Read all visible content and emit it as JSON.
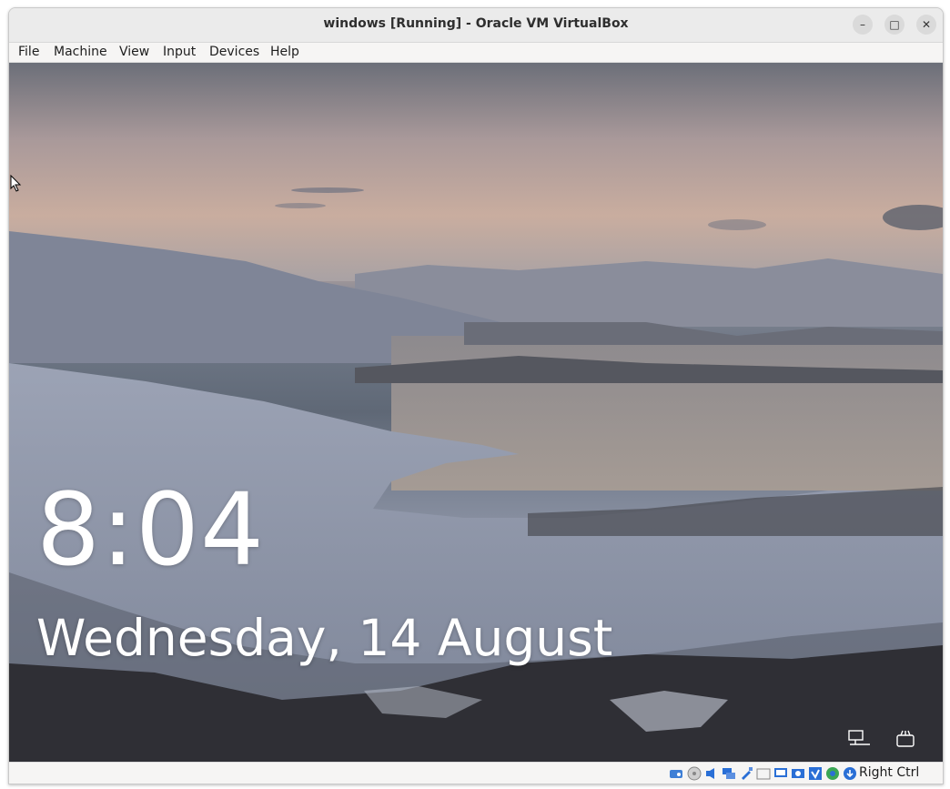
{
  "window": {
    "title": "windows [Running] - Oracle VM VirtualBox"
  },
  "window_controls": {
    "minimize": "–",
    "maximize": "□",
    "close": "✕"
  },
  "menu": [
    "File",
    "Machine",
    "View",
    "Input",
    "Devices",
    "Help"
  ],
  "lockscreen": {
    "time": "8:04",
    "date": "Wednesday, 14 August",
    "icons": [
      "network-icon",
      "accessibility-icon"
    ]
  },
  "statusbar": {
    "icons": [
      "hard-disk-icon",
      "optical-drive-icon",
      "audio-icon",
      "network-adapter-icon",
      "usb-icon",
      "shared-folders-icon",
      "display-icon",
      "recording-icon",
      "cpu-icon",
      "guest-additions-icon",
      "mouse-integration-icon",
      "keyboard-capture-icon"
    ],
    "host_key": "Right Ctrl"
  },
  "colors": {
    "titlebar": "#ebebeb",
    "menubar": "#f6f5f4",
    "accent": "#2a6fd6"
  }
}
